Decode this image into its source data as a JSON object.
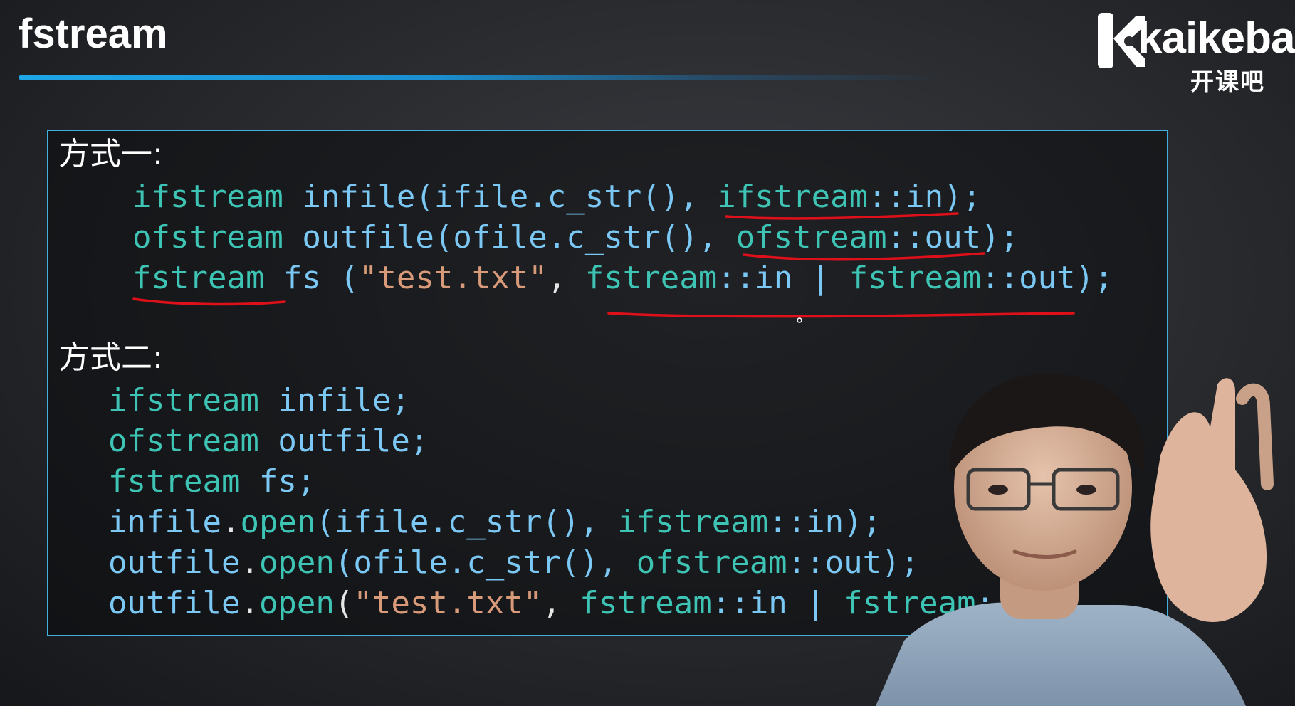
{
  "slide": {
    "title": "fstream"
  },
  "logo": {
    "wordmark": "kaikeba",
    "chinese": "开课吧",
    "icon": "kaikeba-k-logo-icon"
  },
  "method1": {
    "heading": "方式一:",
    "lines": [
      {
        "type": "ifstream",
        "var": " infile(ifile.c_str(), ",
        "mode_type": "ifstream",
        "mode": "::in);"
      },
      {
        "type": "ofstream",
        "var": " outfile(ofile.c_str(), ",
        "mode_type": "ofstream",
        "mode": "::out);"
      },
      {
        "type": "fstream",
        "var": " fs (",
        "str": "\"test.txt\"",
        "sep": ", ",
        "mode_type": "fstream",
        "mode": "::in | ",
        "mode_type2": "fstream",
        "mode2": "::out);"
      }
    ]
  },
  "method2": {
    "heading": "方式二:",
    "decl": [
      {
        "type": "ifstream",
        "rest": " infile;"
      },
      {
        "type": "ofstream",
        "rest": " outfile;"
      },
      {
        "type": "fstream",
        "rest": " fs;"
      }
    ],
    "calls": [
      {
        "obj": "infile",
        "dot": ".",
        "fn": "open",
        "arg": "(ifile.c_str(), ",
        "mode_type": "ifstream",
        "mode": "::in);"
      },
      {
        "obj": "outfile",
        "dot": ".",
        "fn": "open",
        "arg": "(ofile.c_str(), ",
        "mode_type": "ofstream",
        "mode": "::out);"
      },
      {
        "obj": "outfile",
        "dot": ".",
        "fn": "open",
        "open_paren": "(",
        "str": "\"test.txt\"",
        "sep": ", ",
        "mode_type": "fstream",
        "mode": "::in | ",
        "mode_type2": "fstream",
        "mode2": "::"
      }
    ]
  },
  "colors": {
    "type": "#3ec4b4",
    "identifier": "#7cc8f5",
    "string": "#d99a7a",
    "accent": "#1ea6e6",
    "annotation": "#e0101a"
  }
}
